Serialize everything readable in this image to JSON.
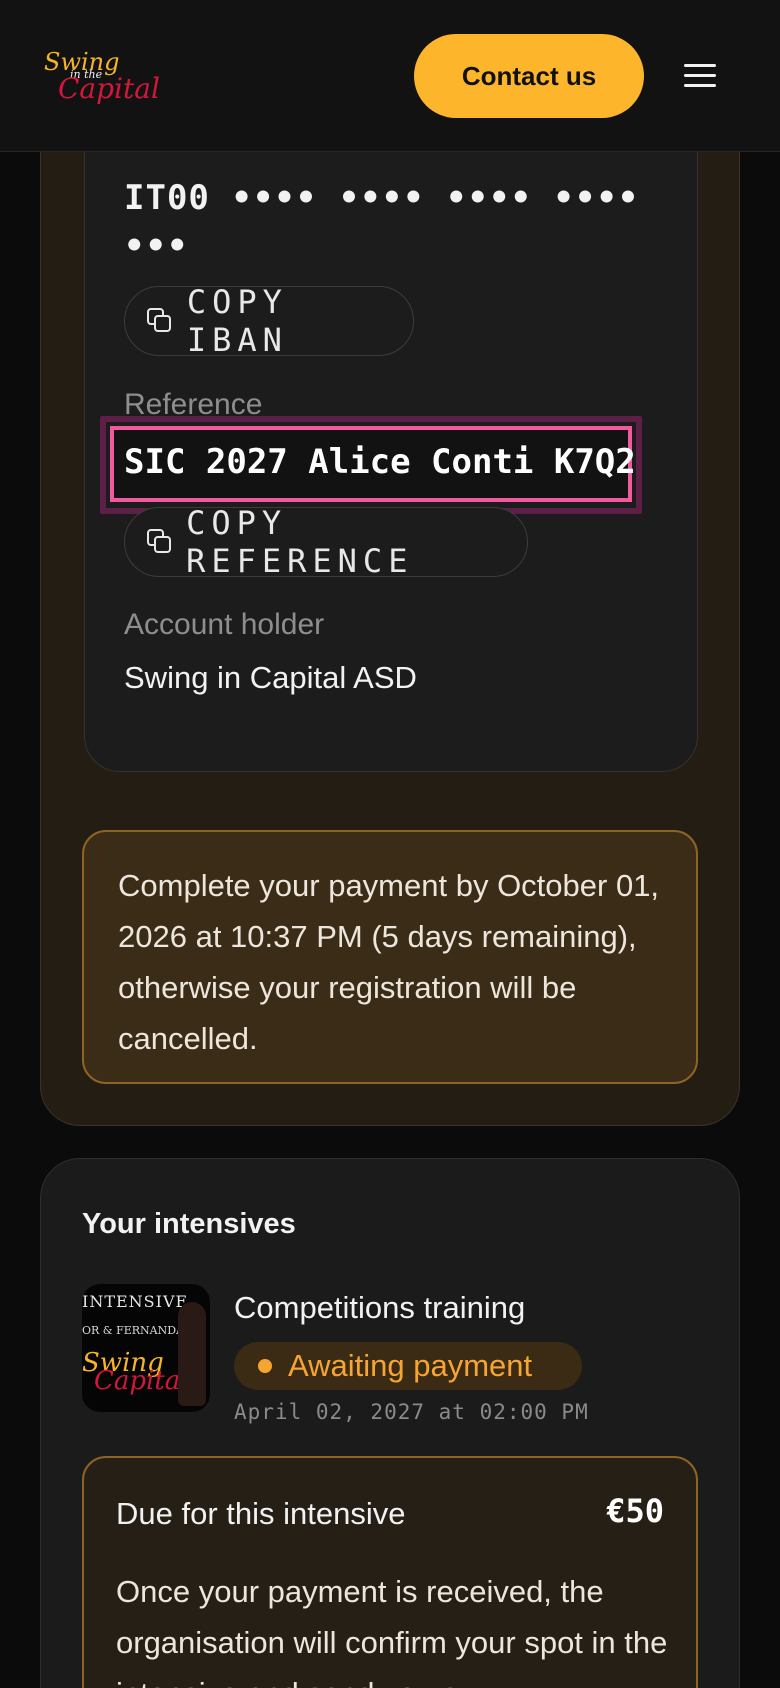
{
  "header": {
    "logo_line1": "Swing",
    "logo_line2": "in the",
    "logo_line3": "Capital",
    "contact_label": "Contact us"
  },
  "payment": {
    "iban_masked": "IT00 •••• •••• •••• •••• •••",
    "copy_iban_label": "COPY IBAN",
    "reference_label": "Reference",
    "reference_value": "SIC 2027 Alice Conti K7Q2",
    "copy_reference_label": "COPY REFERENCE",
    "holder_label": "Account holder",
    "holder_value": "Swing in Capital ASD",
    "deadline_notice": "Complete your payment by October 01, 2026 at 10:37 PM (5 days remaining), otherwise your registration will be cancelled."
  },
  "intensives": {
    "title": "Your intensives",
    "items": [
      {
        "thumb_title": "INTENSIVE",
        "thumb_subtitle": "OR & FERNANDA",
        "thumb_logo_top": "Swing",
        "thumb_logo_bottom": "Capital",
        "name": "Competitions training",
        "status": "Awaiting payment",
        "date": "April 02, 2027 at 02:00 PM",
        "due_label": "Due for this intensive",
        "due_amount": "€50",
        "due_text": "Once your payment is received, the organisation will confirm your spot in the intensive and send you a"
      }
    ]
  },
  "colors": {
    "accent": "#fdb62b",
    "status": "#f6a530",
    "highlight": "#f2599f",
    "logo_red": "#d3173a"
  }
}
